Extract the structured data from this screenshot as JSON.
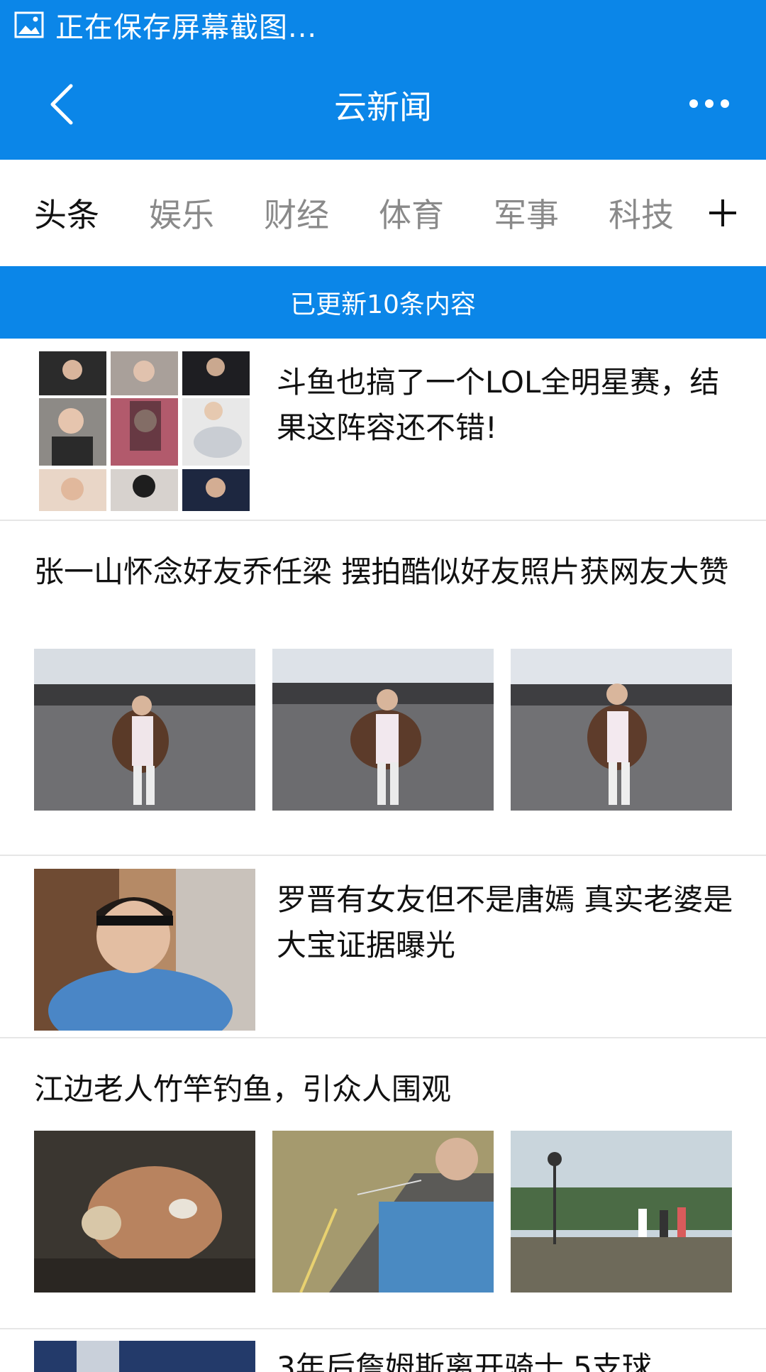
{
  "status_bar": {
    "text": "正在保存屏幕截图...",
    "icon": "image-icon"
  },
  "header": {
    "title": "云新闻",
    "back_icon": "back-chevron-icon",
    "more_icon": "more-dots-icon"
  },
  "tabs": [
    {
      "label": "头条",
      "active": true
    },
    {
      "label": "娱乐"
    },
    {
      "label": "财经"
    },
    {
      "label": "体育"
    },
    {
      "label": "军事"
    },
    {
      "label": "科技"
    }
  ],
  "add_tab_icon": "plus-icon",
  "update_banner": "已更新10条内容",
  "articles": [
    {
      "headline": "斗鱼也搞了一个LOL全明星赛，结果这阵容还不错!"
    },
    {
      "headline": "张一山怀念好友乔任梁 摆拍酷似好友照片获网友大赞"
    },
    {
      "headline": "罗晋有女友但不是唐嫣 真实老婆是大宝证据曝光"
    },
    {
      "headline": "江边老人竹竿钓鱼，引众人围观"
    },
    {
      "headline": "3年后詹姆斯离开骑士 5支球"
    }
  ],
  "colors": {
    "brand": "#0b86e8",
    "text": "#111111",
    "muted": "#8a8a8a"
  }
}
